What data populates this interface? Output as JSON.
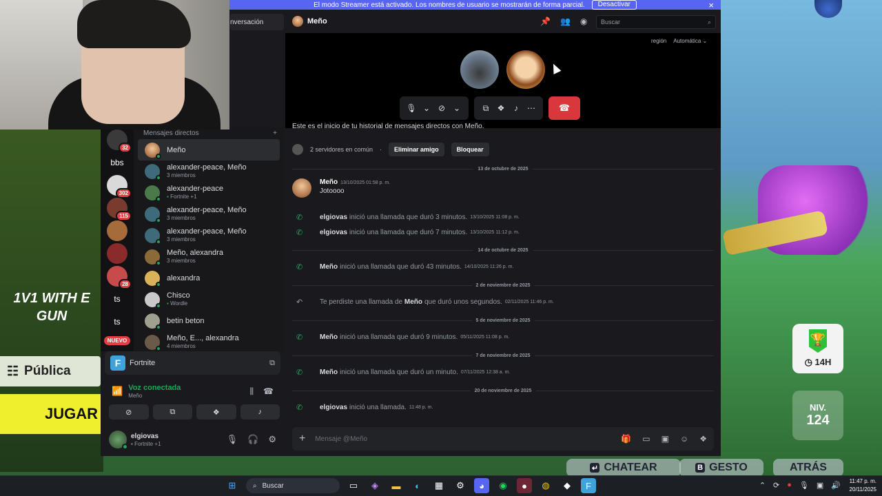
{
  "streamer_bar": {
    "text": "El modo Streamer está activado. Los nombres de usuario se mostrarán de forma parcial.",
    "button": "Desactivar",
    "close": "×"
  },
  "sidebar": {
    "convo_snippet": "nversación",
    "dm_header": "Mensajes directos",
    "add": "+",
    "servers": [
      {
        "label": "",
        "badge": "32",
        "color": "#3a3a3a"
      },
      {
        "label": "bbs",
        "badge": "",
        "color": "#121214"
      },
      {
        "label": "",
        "badge": "302",
        "color": "#d9d9d9"
      },
      {
        "label": "",
        "badge": "115",
        "color": "#7a3b2f"
      },
      {
        "label": "",
        "badge": "",
        "color": "#a66b3b"
      },
      {
        "label": "",
        "badge": "",
        "color": "#8a2a2a"
      },
      {
        "label": "",
        "badge": "28",
        "color": "#c84b4b"
      },
      {
        "label": "ts",
        "badge": "",
        "color": "#121214"
      },
      {
        "label": "ts",
        "badge": "",
        "color": "#121214"
      }
    ],
    "nuevo": "NUEVO",
    "dms": [
      {
        "name": "Meño",
        "sub": "",
        "active": true
      },
      {
        "name": "alexander-peace, Meño",
        "sub": "3 miembros"
      },
      {
        "name": "alexander-peace",
        "sub": "Fortnite +1",
        "game": true
      },
      {
        "name": "alexander-peace, Meño",
        "sub": "3 miembros"
      },
      {
        "name": "alexander-peace, Meño",
        "sub": "3 miembros"
      },
      {
        "name": "Meño, alexandra",
        "sub": "3 miembros"
      },
      {
        "name": "alexandra",
        "sub": ""
      },
      {
        "name": "Chisco",
        "sub": "Wordle",
        "game": true
      },
      {
        "name": "betin beton",
        "sub": ""
      },
      {
        "name": "Meño, E..., alexandra",
        "sub": "4 miembros"
      }
    ],
    "activity": {
      "icon": "F",
      "label": "Fortnite"
    },
    "voice": {
      "status": "Voz conectada",
      "channel": "Meño"
    },
    "user": {
      "name": "elgiovas",
      "status": "Fortnite +1"
    }
  },
  "header": {
    "title": "Meño",
    "search_placeholder": "Buscar",
    "region_label": "región",
    "region_value": "Automática"
  },
  "chat": {
    "history_text": "Este es el inicio de tu historial de mensajes directos con Meño.",
    "mutual_servers": "2 servidores en común",
    "remove_friend": "Eliminar amigo",
    "block": "Bloquear",
    "messages": [
      {
        "type": "divider",
        "date": "13 de octubre de 2025"
      },
      {
        "type": "msg",
        "author": "Meño",
        "time": "13/10/2025 01:58 p. m.",
        "text": "Jotoooo"
      },
      {
        "type": "call",
        "author": "elgiovas",
        "text": "inició una llamada que duró 3 minutos.",
        "time": "13/10/2025 11:08 p. m."
      },
      {
        "type": "call",
        "author": "elgiovas",
        "text": "inició una llamada que duró 7 minutos.",
        "time": "13/10/2025 11:12 p. m."
      },
      {
        "type": "divider",
        "date": "14 de octubre de 2025"
      },
      {
        "type": "call",
        "author": "Meño",
        "text": "inició una llamada que duró 43 minutos.",
        "time": "14/10/2025 11:26 p. m."
      },
      {
        "type": "divider",
        "date": "2 de noviembre de 2025"
      },
      {
        "type": "missed",
        "pre": "Te perdiste una llamada de",
        "author": "Meño",
        "text": "que duró unos segundos.",
        "time": "02/11/2025 11:46 p. m."
      },
      {
        "type": "divider",
        "date": "5 de noviembre de 2025"
      },
      {
        "type": "call",
        "author": "Meño",
        "text": "inició una llamada que duró 9 minutos.",
        "time": "05/11/2025 11:08 p. m."
      },
      {
        "type": "divider",
        "date": "7 de noviembre de 2025"
      },
      {
        "type": "call",
        "author": "Meño",
        "text": "inició una llamada que duró un minuto.",
        "time": "07/11/2025 12:38 a. m."
      },
      {
        "type": "divider",
        "date": "20 de noviembre de 2025"
      },
      {
        "type": "call",
        "author": "elgiovas",
        "text": "inició una llamada.",
        "time": "11:48 p. m."
      }
    ],
    "composer_placeholder": "Mensaje @Meño"
  },
  "game": {
    "banner": "1V1 WITH E… GUN",
    "banner_line1": "1V1 WITH E",
    "banner_line2": "GUN",
    "publica": "Pública",
    "jugar": "JUGAR",
    "trophy_time": "14H",
    "level_label": "NIV.",
    "level_value": "124",
    "btn_chat": "CHATEAR",
    "btn_chat_key": "",
    "btn_gesture": "GESTO",
    "btn_gesture_key": "B",
    "btn_back": "ATRÁS"
  },
  "taskbar": {
    "search": "Buscar",
    "time": "11:47 p. m.",
    "date": "20/11/2025"
  }
}
